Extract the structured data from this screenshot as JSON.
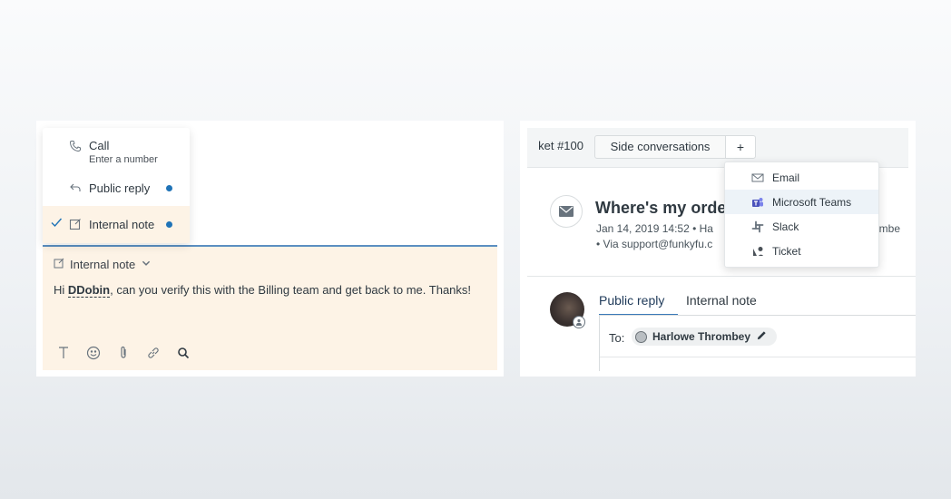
{
  "left": {
    "menu": {
      "call_label": "Call",
      "call_sub": "Enter a number",
      "public_label": "Public reply",
      "internal_label": "Internal note",
      "dot_color": "#1f73b7"
    },
    "composer": {
      "header_label": "Internal note",
      "body_prefix": "Hi ",
      "mention": "DDobin",
      "body_suffix": ", can you verify this with the Billing team and get back to me. Thanks!",
      "background": "#fdf3e6"
    },
    "toolbar_icons": [
      "text-format-icon",
      "emoji-icon",
      "attachment-icon",
      "link-icon",
      "search-icon"
    ]
  },
  "right": {
    "tabs": {
      "ticket_label": "ket #100",
      "side_label": "Side conversations",
      "add_label": "+"
    },
    "ticket": {
      "title": "Where's my orde",
      "meta": "Jan 14, 2019 14:52 • Ha",
      "meta_right": "ombe",
      "via": "• Via support@funkyfu.c"
    },
    "side_menu": [
      {
        "label": "Email",
        "icon": "email-icon"
      },
      {
        "label": "Microsoft Teams",
        "icon": "microsoft-teams-icon"
      },
      {
        "label": "Slack",
        "icon": "slack-icon"
      },
      {
        "label": "Ticket",
        "icon": "ticket-icon"
      }
    ],
    "reply": {
      "public_tab": "Public reply",
      "internal_tab": "Internal note",
      "to_label": "To:",
      "recipient": "Harlowe Thrombey"
    }
  }
}
